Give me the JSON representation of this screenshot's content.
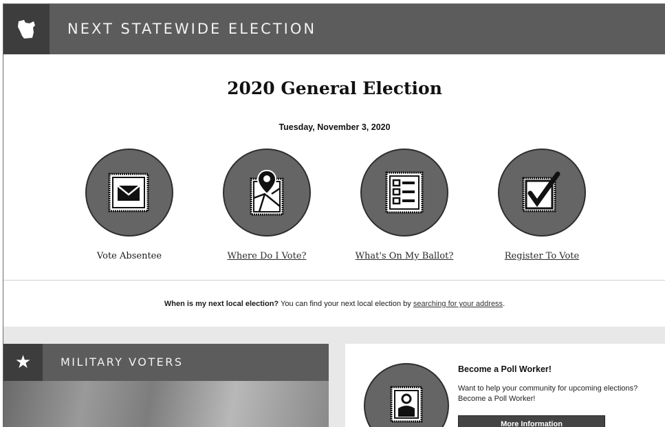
{
  "header": {
    "title": "NEXT STATEWIDE ELECTION",
    "icon": "wisconsin-state-icon"
  },
  "election": {
    "title": "2020 General Election",
    "date": "Tuesday, November 3, 2020"
  },
  "actions": [
    {
      "label": "Vote Absentee",
      "icon": "envelope-icon",
      "linked": false
    },
    {
      "label": "Where Do I Vote?",
      "icon": "map-pin-icon",
      "linked": true
    },
    {
      "label": "What's On My Ballot?",
      "icon": "ballot-list-icon",
      "linked": true
    },
    {
      "label": "Register To Vote",
      "icon": "checkbox-icon",
      "linked": true
    }
  ],
  "local": {
    "question": "When is my next local election?",
    "text": " You can find your next local election by ",
    "link": "searching for your address",
    "end": "."
  },
  "military": {
    "title": "MILITARY VOTERS",
    "icon": "star-icon"
  },
  "poll_worker": {
    "title": "Become a Poll Worker!",
    "text": "Want to help your community for upcoming elections? Become a Poll Worker!",
    "button": "More Information",
    "icon": "poll-worker-icon"
  },
  "colors": {
    "header": "#5c5c5c",
    "header_dark": "#3d3d3d",
    "circle": "#656565"
  }
}
